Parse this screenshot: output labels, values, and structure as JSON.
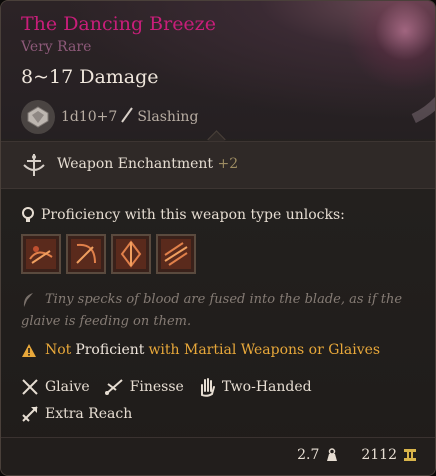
{
  "item": {
    "name": "The Dancing Breeze",
    "rarity": "Very Rare",
    "damage": "8~17 Damage",
    "dice": "1d10+7",
    "damage_type": "Slashing"
  },
  "enchantment": {
    "label": "Weapon Enchantment",
    "value": "+2"
  },
  "proficiency": {
    "heading": "Proficiency with this weapon type unlocks:",
    "actions": [
      {
        "icon": "action-icon-1"
      },
      {
        "icon": "action-icon-2"
      },
      {
        "icon": "action-icon-3"
      },
      {
        "icon": "action-icon-4"
      }
    ]
  },
  "flavor": "Tiny specks of blood are fused into the blade, as if the glaive is feeding on them.",
  "warning": {
    "not": "Not",
    "proficient": "Proficient",
    "rest": "with Martial Weapons or Glaives"
  },
  "properties": [
    "Glaive",
    "Finesse",
    "Two-Handed",
    "Extra Reach"
  ],
  "footer": {
    "weight": "2.7",
    "value": "2112"
  },
  "colors": {
    "title": "#c81e7a",
    "rarity": "#8e5a7a",
    "warning": "#e8a83a",
    "enchant_bonus": "#9d8c62"
  }
}
